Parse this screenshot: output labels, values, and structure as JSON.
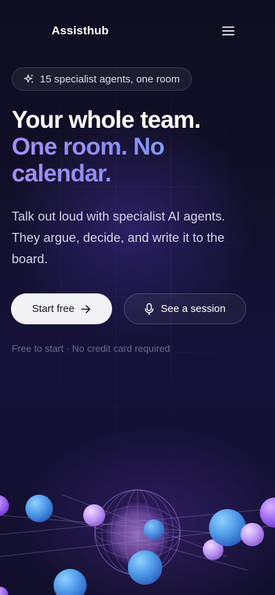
{
  "brand": {
    "name": "Assisthub",
    "logo_icon": "waveform-icon"
  },
  "header": {
    "menu_icon": "hamburger-menu-icon"
  },
  "badge": {
    "icon": "sparkle-icon",
    "text": "15 specialist agents, one room"
  },
  "hero": {
    "headline_line1": "Your whole team.",
    "headline_line2": "One room. No",
    "headline_line3": "calendar.",
    "subtitle": "Talk out loud with specialist AI agents. They argue, decide, and write it to the board."
  },
  "cta": {
    "primary_label": "Start free",
    "primary_icon": "arrow-right-icon",
    "secondary_label": "See a session",
    "secondary_icon": "microphone-icon"
  },
  "fineprint": "Free to start · No credit card required",
  "colors": {
    "background": "#0d0b1c",
    "accent_purple": "#a98cf5",
    "accent_blue": "#6aa6f0",
    "button_light": "#f2f1f5"
  }
}
